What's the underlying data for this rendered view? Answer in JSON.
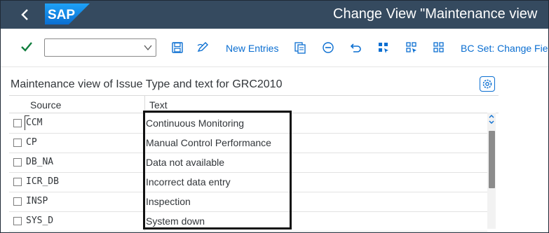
{
  "shell": {
    "title": "Change View \"Maintenance view",
    "logo_text": "SAP",
    "back_icon": "chevron-left-icon"
  },
  "toolbar": {
    "command_field_value": "",
    "new_entries_label": "New Entries",
    "bc_set_label": "BC Set: Change Fie"
  },
  "table": {
    "title": "Maintenance view of Issue Type and text for GRC2010",
    "columns": [
      "Source",
      "Text"
    ],
    "rows": [
      {
        "source": "CCM",
        "text": "Continuous Monitoring"
      },
      {
        "source": "CP",
        "text": "Manual Control Performance"
      },
      {
        "source": "DB_NA",
        "text": "Data not available"
      },
      {
        "source": "ICR_DB",
        "text": "Incorrect data entry"
      },
      {
        "source": "INSP",
        "text": "Inspection"
      },
      {
        "source": "SYS_D",
        "text": "System down"
      }
    ]
  },
  "colors": {
    "shell_bg": "#354a5f",
    "accent": "#0a6ed1",
    "check": "#107e3e"
  }
}
